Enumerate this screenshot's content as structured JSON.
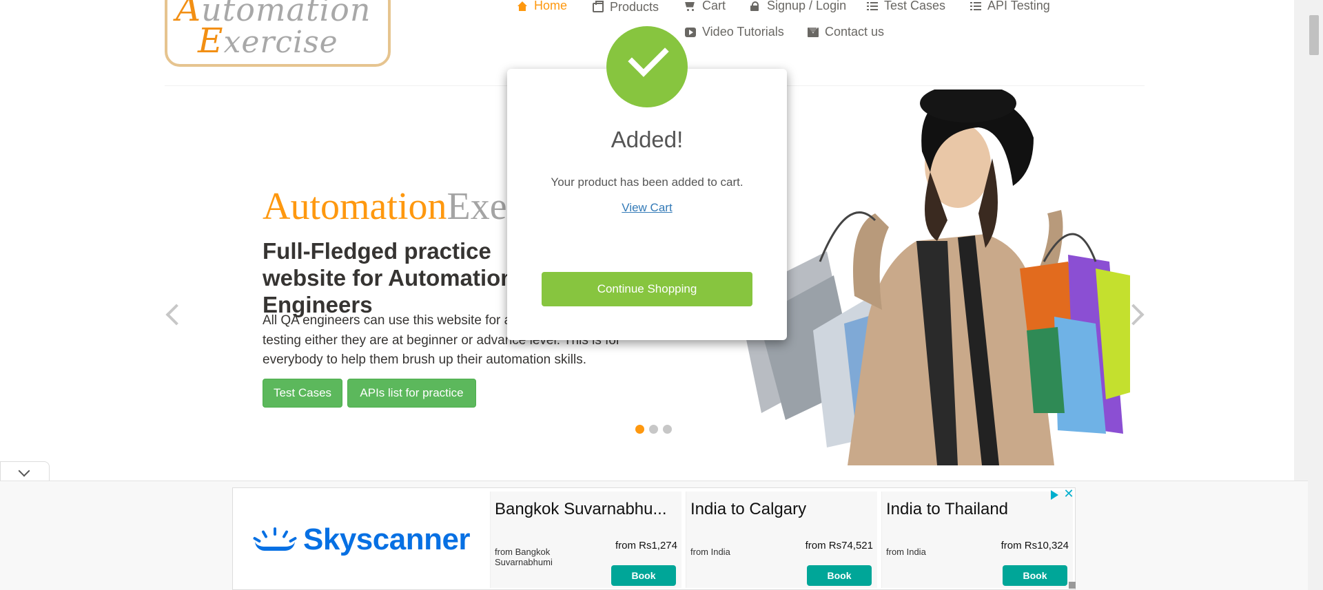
{
  "logo": {
    "line1_cap": "A",
    "line1_rest": "utomation",
    "line2_cap": "E",
    "line2_rest": "xercise"
  },
  "nav": {
    "home": "Home",
    "products": "Products",
    "cart": "Cart",
    "signup": "Signup / Login",
    "test_cases": "Test Cases",
    "api_testing": "API Testing",
    "video": "Video Tutorials",
    "contact": "Contact us"
  },
  "hero": {
    "brand_a": "Automation",
    "brand_b": "Exercise",
    "headline": "Full-Fledged practice website for Automation Engineers",
    "description": "All QA engineers can use this website for automation practice and API testing either they are at beginner or advance level. This is for everybody to help them brush up their automation skills.",
    "btn_test_cases": "Test Cases",
    "btn_apis": "APIs list for practice"
  },
  "modal": {
    "title": "Added!",
    "message": "Your product has been added to cart.",
    "link": "View Cart",
    "button": "Continue Shopping"
  },
  "ad": {
    "brand": "Skyscanner",
    "cards": [
      {
        "title": "Bangkok Suvarnabhu...",
        "from": "from Bangkok Suvarnabhumi",
        "price": "from Rs1,274",
        "button": "Book"
      },
      {
        "title": "India to Calgary",
        "from": "from India",
        "price": "from Rs74,521",
        "button": "Book"
      },
      {
        "title": "India to Thailand",
        "from": "from India",
        "price": "from Rs10,324",
        "button": "Book"
      }
    ],
    "close": "✕"
  },
  "colors": {
    "accent": "#fe980f",
    "success": "#87c53f",
    "button_green": "#5cb85c",
    "skyscanner_blue": "#0770e3",
    "book_teal": "#00a698"
  }
}
